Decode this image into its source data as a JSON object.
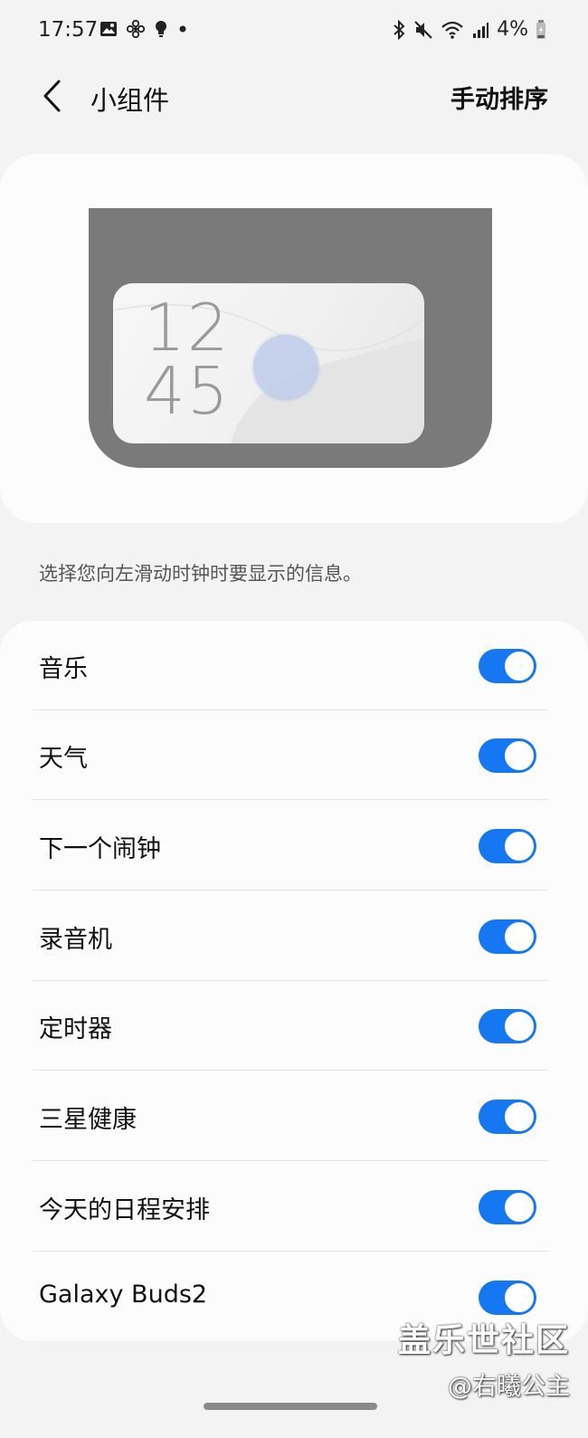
{
  "status_bar": {
    "time": "17:57",
    "battery": "4%",
    "left_icons": [
      "gallery-icon",
      "fan-icon",
      "bulb-icon",
      "dot-icon"
    ],
    "right_icons": [
      "bluetooth-icon",
      "mute-icon",
      "wifi-icon",
      "signal-icon",
      "battery-icon"
    ]
  },
  "header": {
    "title": "小组件",
    "action": "手动排序"
  },
  "preview": {
    "clock": "12\n45"
  },
  "description": "选择您向左滑动时钟时要显示的信息。",
  "widgets": [
    {
      "label": "音乐",
      "enabled": true
    },
    {
      "label": "天气",
      "enabled": true
    },
    {
      "label": "下一个闹钟",
      "enabled": true
    },
    {
      "label": "录音机",
      "enabled": true
    },
    {
      "label": "定时器",
      "enabled": true
    },
    {
      "label": "三星健康",
      "enabled": true
    },
    {
      "label": "今天的日程安排",
      "enabled": true
    },
    {
      "label": "Galaxy Buds2",
      "enabled": true
    }
  ],
  "watermark": {
    "line1": "盖乐世社区",
    "line2": "@右曦公主"
  },
  "colors": {
    "accent": "#1677f2",
    "background": "#f3f3f3",
    "card": "#fcfcfc"
  }
}
